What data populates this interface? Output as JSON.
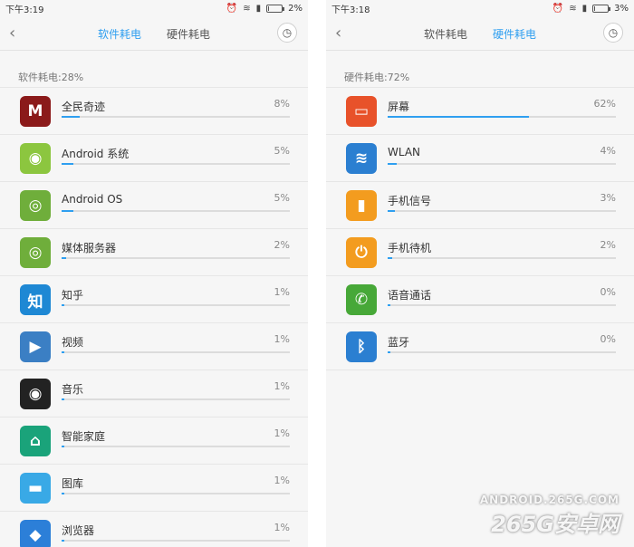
{
  "left": {
    "status": {
      "time": "下午3:19",
      "battery": "2%"
    },
    "tabs": [
      {
        "label": "软件耗电",
        "active": true
      },
      {
        "label": "硬件耗电",
        "active": false
      }
    ],
    "summary": "软件耗电:28%",
    "items": [
      {
        "name": "全民奇迹",
        "percent": "8%",
        "fraction": 0.08,
        "icon": "game-icon",
        "color": "#8b1a1a",
        "glyph": "M"
      },
      {
        "name": "Android 系统",
        "percent": "5%",
        "fraction": 0.05,
        "icon": "android-icon",
        "color": "#8cc63f",
        "glyph": "◉"
      },
      {
        "name": "Android OS",
        "percent": "5%",
        "fraction": 0.05,
        "icon": "android-os-icon",
        "color": "#6fae3b",
        "glyph": "◎"
      },
      {
        "name": "媒体服务器",
        "percent": "2%",
        "fraction": 0.02,
        "icon": "media-server-icon",
        "color": "#6fae3b",
        "glyph": "◎"
      },
      {
        "name": "知乎",
        "percent": "1%",
        "fraction": 0.01,
        "icon": "zhihu-icon",
        "color": "#1e88d4",
        "glyph": "知"
      },
      {
        "name": "视频",
        "percent": "1%",
        "fraction": 0.01,
        "icon": "video-icon",
        "color": "#3b7fc4",
        "glyph": "▶"
      },
      {
        "name": "音乐",
        "percent": "1%",
        "fraction": 0.01,
        "icon": "music-icon",
        "color": "#222222",
        "glyph": "◉"
      },
      {
        "name": "智能家庭",
        "percent": "1%",
        "fraction": 0.01,
        "icon": "smart-home-icon",
        "color": "#1aa37a",
        "glyph": "⌂"
      },
      {
        "name": "图库",
        "percent": "1%",
        "fraction": 0.01,
        "icon": "gallery-icon",
        "color": "#39a9e6",
        "glyph": "▬"
      },
      {
        "name": "浏览器",
        "percent": "1%",
        "fraction": 0.01,
        "icon": "browser-icon",
        "color": "#2c7fd8",
        "glyph": "◆"
      }
    ]
  },
  "right": {
    "status": {
      "time": "下午3:18",
      "battery": "3%"
    },
    "tabs": [
      {
        "label": "软件耗电",
        "active": false
      },
      {
        "label": "硬件耗电",
        "active": true
      }
    ],
    "summary": "硬件耗电:72%",
    "items": [
      {
        "name": "屏幕",
        "percent": "62%",
        "fraction": 0.62,
        "icon": "screen-icon",
        "color": "#e8522a",
        "glyph": "▭"
      },
      {
        "name": "WLAN",
        "percent": "4%",
        "fraction": 0.04,
        "icon": "wifi-icon",
        "color": "#2b7fd1",
        "glyph": "≋"
      },
      {
        "name": "手机信号",
        "percent": "3%",
        "fraction": 0.03,
        "icon": "signal-icon",
        "color": "#f39c1f",
        "glyph": "▮"
      },
      {
        "name": "手机待机",
        "percent": "2%",
        "fraction": 0.02,
        "icon": "power-icon",
        "color": "#f39c1f",
        "glyph": "⏻"
      },
      {
        "name": "语音通话",
        "percent": "0%",
        "fraction": 0.0,
        "icon": "phone-icon",
        "color": "#47a838",
        "glyph": "✆"
      },
      {
        "name": "蓝牙",
        "percent": "0%",
        "fraction": 0.0,
        "icon": "bluetooth-icon",
        "color": "#2b7fd1",
        "glyph": "ᛒ"
      }
    ]
  },
  "watermark": {
    "line1": "ANDROID.265G.COM",
    "line2": "265G安卓网"
  }
}
